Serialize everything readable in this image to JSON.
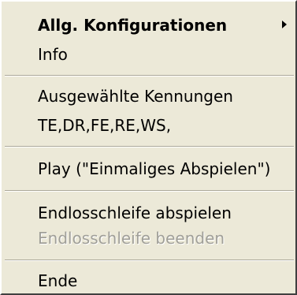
{
  "menu": {
    "items": [
      {
        "label": "Allg. Konfigurationen",
        "bold": true,
        "submenu": true
      },
      {
        "label": "Info"
      },
      {
        "label": "Ausgewählte Kennungen"
      },
      {
        "label": "TE,DR,FE,RE,WS,"
      },
      {
        "label": "Play (\"Einmaliges Abspielen\")"
      },
      {
        "label": "Endlosschleife abspielen"
      },
      {
        "label": "Endlosschleife beenden",
        "disabled": true
      },
      {
        "label": "Ende"
      }
    ],
    "colors": {
      "background": "#ece9d8",
      "text": "#000000",
      "disabled_text": "#a09f98",
      "separator_dark": "#aca899",
      "separator_light": "#ffffff"
    }
  }
}
